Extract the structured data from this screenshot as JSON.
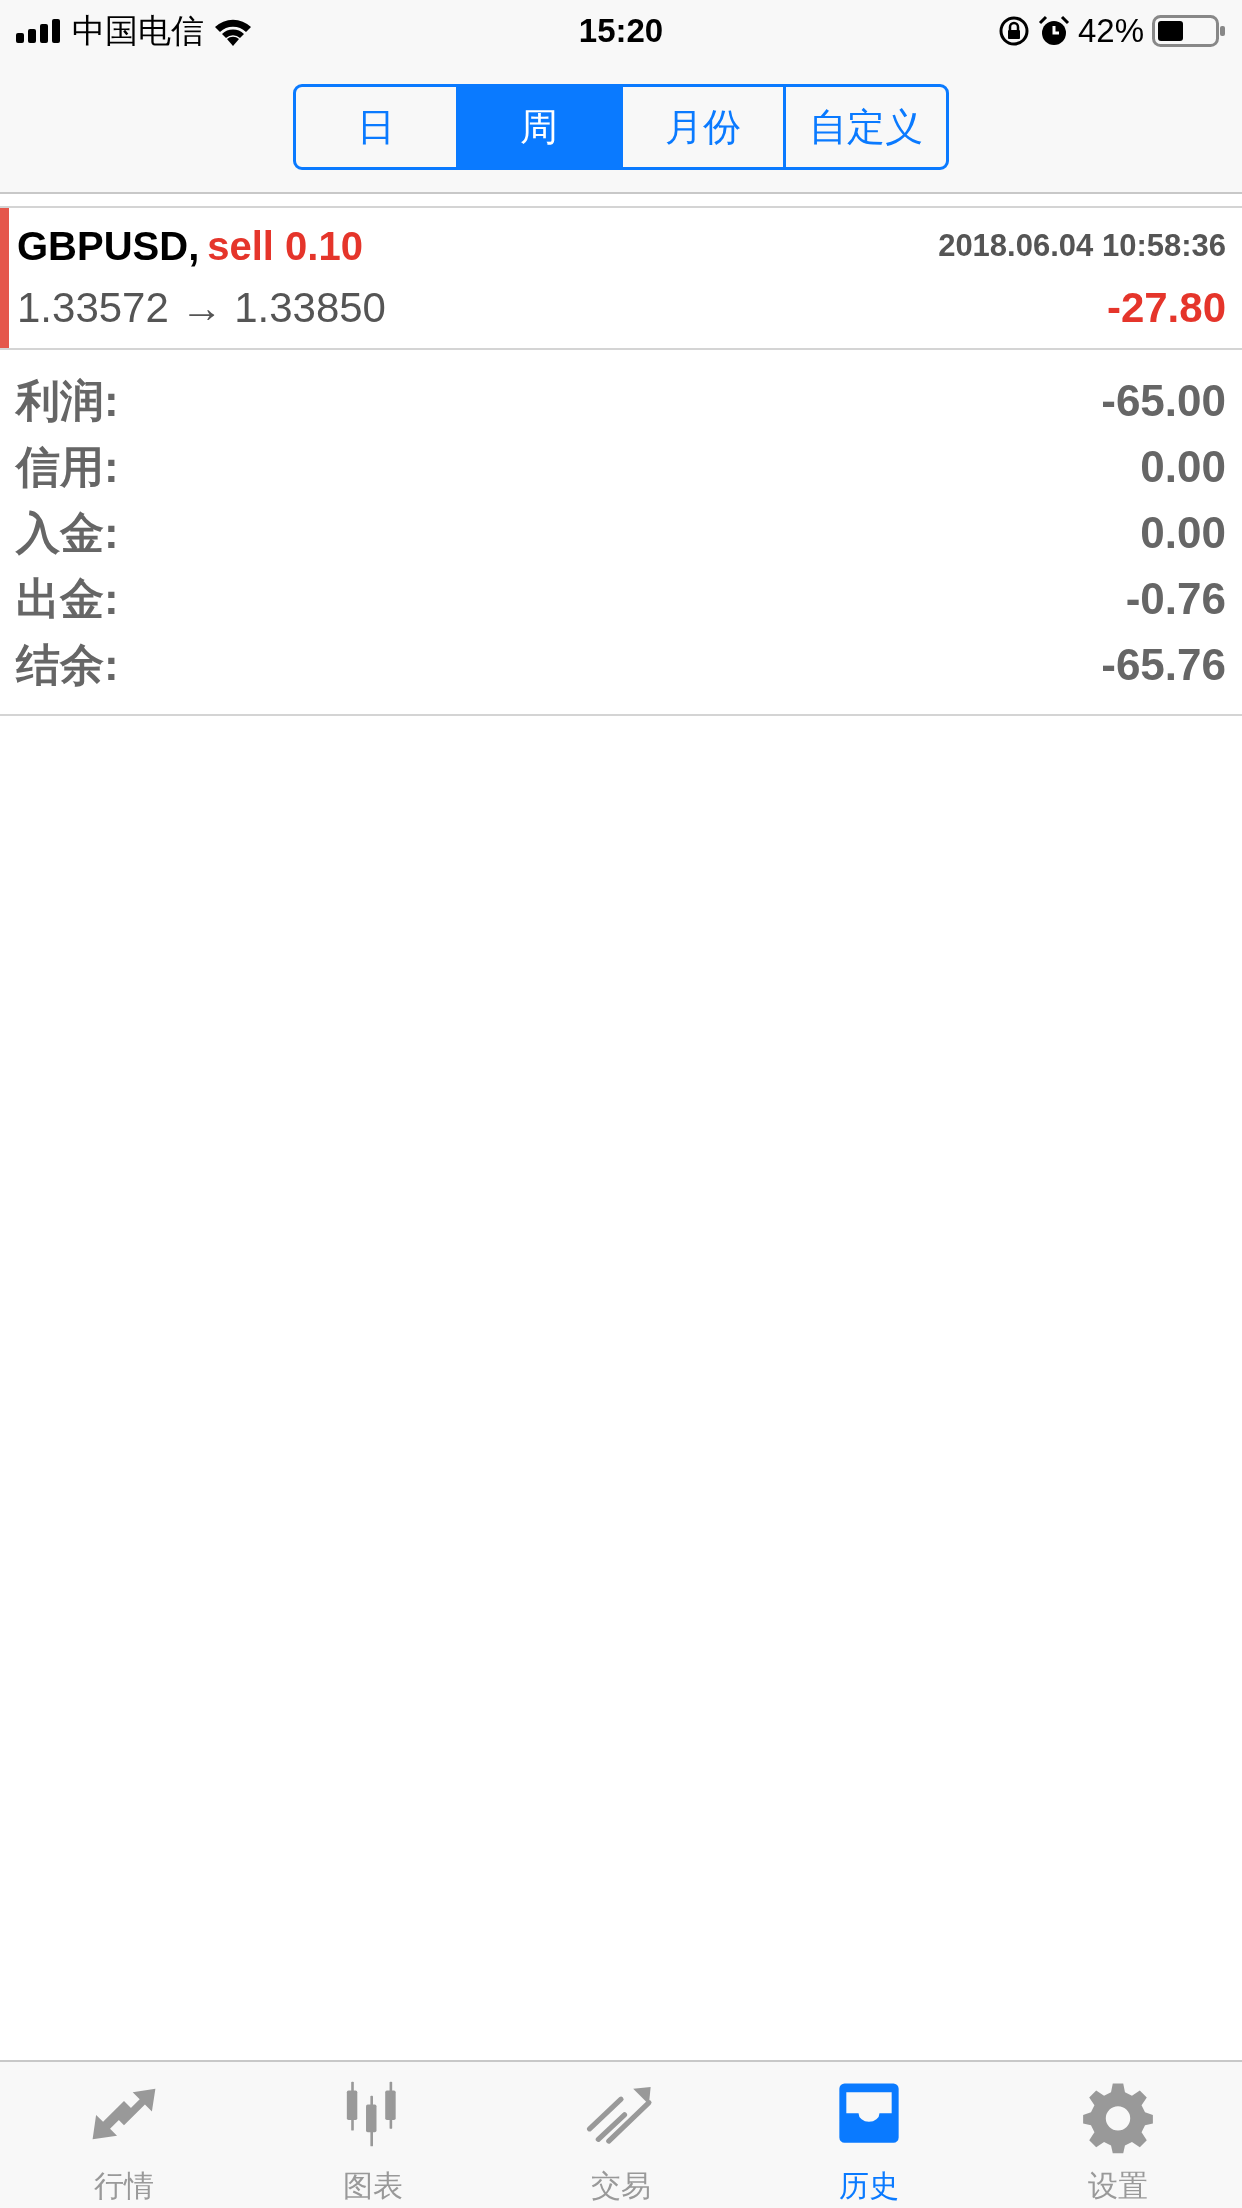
{
  "status_bar": {
    "carrier": "中国电信",
    "time": "15:20",
    "battery": "42%"
  },
  "period_tabs": [
    {
      "label": "日",
      "selected": false
    },
    {
      "label": "周",
      "selected": true
    },
    {
      "label": "月份",
      "selected": false
    },
    {
      "label": "自定义",
      "selected": false
    }
  ],
  "deals": [
    {
      "symbol": "GBPUSD,",
      "side": "sell 0.10",
      "time": "2018.06.04 10:58:36",
      "prices": "1.33572 → 1.33850",
      "profit": "-27.80",
      "color": "#e5574b"
    }
  ],
  "summary": [
    {
      "label": "利润:",
      "value": "-65.00"
    },
    {
      "label": "信用:",
      "value": "0.00"
    },
    {
      "label": "入金:",
      "value": "0.00"
    },
    {
      "label": "出金:",
      "value": "-0.76"
    },
    {
      "label": "结余:",
      "value": "-65.76"
    }
  ],
  "tab_bar": [
    {
      "kind": "quotes",
      "label": "行情",
      "selected": false
    },
    {
      "kind": "chart",
      "label": "图表",
      "selected": false
    },
    {
      "kind": "trade",
      "label": "交易",
      "selected": false
    },
    {
      "kind": "history",
      "label": "历史",
      "selected": true
    },
    {
      "kind": "settings",
      "label": "设置",
      "selected": false
    }
  ]
}
